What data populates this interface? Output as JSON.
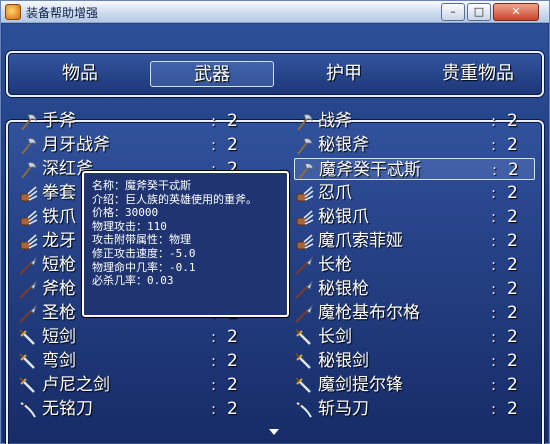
{
  "window": {
    "title": "装备帮助增强",
    "controls": {
      "minimize": "–",
      "maximize": "□",
      "close": "✕"
    }
  },
  "tabs": [
    {
      "label": "物品",
      "selected": false
    },
    {
      "label": "武器",
      "selected": true
    },
    {
      "label": "护甲",
      "selected": false
    },
    {
      "label": "贵重物品",
      "selected": false
    }
  ],
  "separator": ":",
  "items_left": [
    {
      "name": "手斧",
      "count": "2",
      "icon": "axe-icon"
    },
    {
      "name": "月牙战斧",
      "count": "2",
      "icon": "axe-icon"
    },
    {
      "name": "深红斧",
      "count": "2",
      "icon": "axe-icon"
    },
    {
      "name": "拳套",
      "count": "2",
      "icon": "claw-icon"
    },
    {
      "name": "铁爪",
      "count": "2",
      "icon": "claw-icon"
    },
    {
      "name": "龙牙",
      "count": "2",
      "icon": "claw-icon"
    },
    {
      "name": "短枪",
      "count": "2",
      "icon": "spear-icon"
    },
    {
      "name": "斧枪",
      "count": "2",
      "icon": "spear-icon"
    },
    {
      "name": "圣枪",
      "count": "2",
      "icon": "spear-icon"
    },
    {
      "name": "短剑",
      "count": "2",
      "icon": "sword-icon"
    },
    {
      "name": "弯剑",
      "count": "2",
      "icon": "sword-icon"
    },
    {
      "name": "卢尼之剑",
      "count": "2",
      "icon": "sword-icon"
    },
    {
      "name": "无铭刀",
      "count": "2",
      "icon": "katana-icon"
    }
  ],
  "items_right": [
    {
      "name": "战斧",
      "count": "2",
      "icon": "axe-icon"
    },
    {
      "name": "秘银斧",
      "count": "2",
      "icon": "axe-icon"
    },
    {
      "name": "魔斧癸干忒斯",
      "count": "2",
      "icon": "axe-icon",
      "highlighted": true
    },
    {
      "name": "忍爪",
      "count": "2",
      "icon": "claw-icon"
    },
    {
      "name": "秘银爪",
      "count": "2",
      "icon": "claw-icon"
    },
    {
      "name": "魔爪索菲娅",
      "count": "2",
      "icon": "claw-icon"
    },
    {
      "name": "长枪",
      "count": "2",
      "icon": "spear-icon"
    },
    {
      "name": "秘银枪",
      "count": "2",
      "icon": "spear-icon"
    },
    {
      "name": "魔枪基布尔格",
      "count": "2",
      "icon": "spear-icon"
    },
    {
      "name": "长剑",
      "count": "2",
      "icon": "sword-icon"
    },
    {
      "name": "秘银剑",
      "count": "2",
      "icon": "sword-icon"
    },
    {
      "name": "魔剑提尔锋",
      "count": "2",
      "icon": "sword-icon"
    },
    {
      "name": "斩马刀",
      "count": "2",
      "icon": "katana-icon"
    }
  ],
  "tooltip": {
    "lines": [
      "名称：魔斧癸干忒斯",
      "介绍：巨人族的英雄使用的重斧。",
      "价格：30000",
      "物理攻击：110",
      "攻击附带属性：物理",
      "修正攻击速度：-5.0",
      "物理命中几率：-0.1",
      "必杀几率：0.03"
    ]
  },
  "colors": {
    "panel_border": "#e8eefc",
    "window_bg": "#24408a",
    "text": "#ffffff"
  }
}
